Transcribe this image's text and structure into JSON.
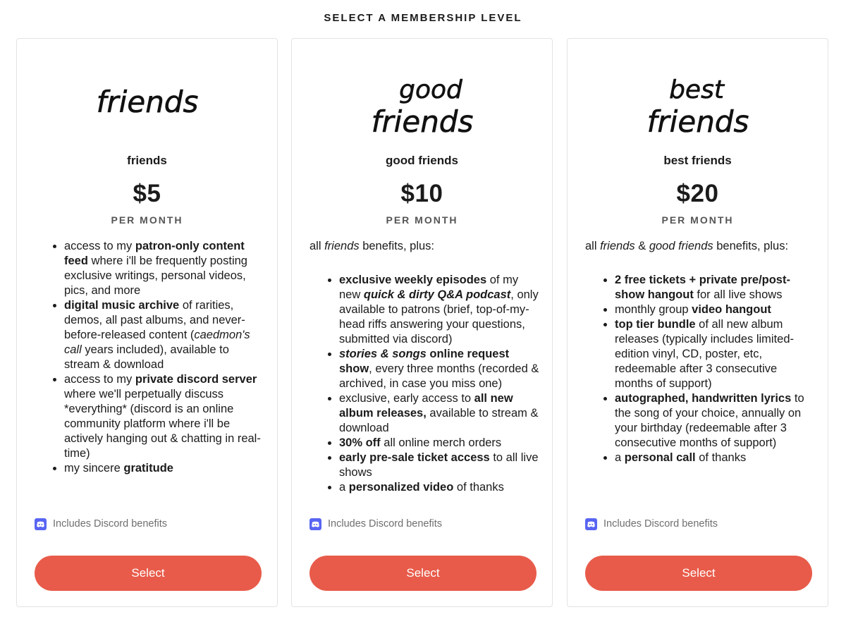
{
  "heading": "SELECT A MEMBERSHIP LEVEL",
  "tiers": [
    {
      "art_text": [
        "friends"
      ],
      "name": "friends",
      "price": "$5",
      "period": "PER MONTH",
      "discord_label": "Includes Discord benefits",
      "select_label": "Select"
    },
    {
      "art_text": [
        "good",
        "friends"
      ],
      "name": "good friends",
      "price": "$10",
      "period": "PER MONTH",
      "discord_label": "Includes Discord benefits",
      "select_label": "Select"
    },
    {
      "art_text": [
        "best",
        "friends"
      ],
      "name": "best friends",
      "price": "$20",
      "period": "PER MONTH",
      "discord_label": "Includes Discord benefits",
      "select_label": "Select"
    }
  ],
  "benefits": {
    "t1": {
      "b1": {
        "p1": "access to my ",
        "p2": "patron-only content feed",
        "p3": " where i'll be frequently posting exclusive writings, personal videos, pics, and more"
      },
      "b2": {
        "p1": "digital music archive",
        "p2": " of rarities, demos, all past albums, and never-before-released content (",
        "p3": "caedmon's call",
        "p4": " years included), available to stream & download"
      },
      "b3": {
        "p1": "access to my ",
        "p2": "private discord server",
        "p3": " where we'll perpetually discuss *everything* (discord is an online community platform where i'll be actively hanging out & chatting in real-time)"
      },
      "b4": {
        "p1": "my sincere ",
        "p2": "gratitude"
      }
    },
    "t2": {
      "intro": {
        "p1": "all ",
        "p2": "friends",
        "p3": " benefits, plus:"
      },
      "b1": {
        "p1": "exclusive weekly episodes",
        "p2": " of my new ",
        "p3": "quick & dirty Q&A podcast",
        "p4": ", only available to patrons (brief, top-of-my-head riffs answering your questions, submitted via discord)"
      },
      "b2": {
        "p1": "stories & songs",
        "p2": " online request show",
        "p3": ", every three months (recorded & archived, in case you miss one)"
      },
      "b3": {
        "p1": "exclusive, early access to ",
        "p2": "all new album releases,",
        "p3": " available to stream & download"
      },
      "b4": {
        "p1": "30% off",
        "p2": " all online merch orders"
      },
      "b5": {
        "p1": "early pre-sale ticket access",
        "p2": " to all live shows"
      },
      "b6": {
        "p1": "a ",
        "p2": "personalized video",
        "p3": " of thanks"
      }
    },
    "t3": {
      "intro": {
        "p1": "all ",
        "p2": "friends",
        "p3": " & ",
        "p4": "good friends",
        "p5": " benefits, plus:"
      },
      "b1": {
        "p1": "2 free tickets + private pre/post-show hangout",
        "p2": " for all live shows"
      },
      "b2": {
        "p1": "monthly group ",
        "p2": "video hangout"
      },
      "b3": {
        "p1": "top tier bundle",
        "p2": " of all new album releases (typically includes limited-edition vinyl, CD, poster, etc, redeemable after 3 consecutive months of support)"
      },
      "b4": {
        "p1": "autographed, handwritten lyrics",
        "p2": " to the song of your choice, annually on your birthday (redeemable after 3 consecutive months of support)"
      },
      "b5": {
        "p1": "a ",
        "p2": "personal call",
        "p3": " of thanks"
      }
    }
  },
  "colors": {
    "button": "#e85b4a",
    "discord_icon": "#5865f2",
    "muted_text": "#6f6f6f"
  },
  "icons": {
    "discord": "discord-icon"
  }
}
